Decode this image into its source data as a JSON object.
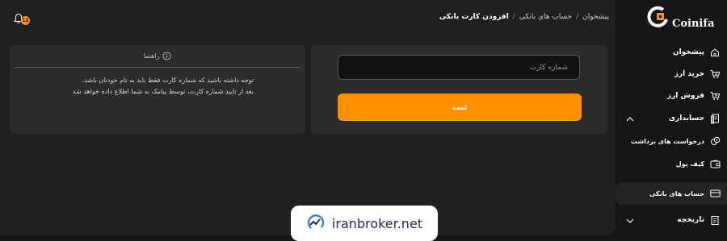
{
  "header": {
    "notification_count": "12",
    "breadcrumb": {
      "home": "پیشخوان",
      "bank_accounts": "حساب های بانکی",
      "current": "افزودن کارت بانکی",
      "separator": "/"
    }
  },
  "form": {
    "card_number_placeholder": "شماره کارت",
    "card_number_value": "",
    "submit_label": "ثبت"
  },
  "guide": {
    "title": "راهنما",
    "lines": [
      "توجه داشته باشید که شماره کارت فقط باید به نام خودتان باشد.",
      "بعد از تایید شماره کارت، توسط پیامک به شما اطلاع داده خواهد شد"
    ]
  },
  "sidebar": {
    "brand": "Coinifa",
    "items": [
      {
        "label": "پیشخوان",
        "icon": "home-icon"
      },
      {
        "label": "خرید ارز",
        "icon": "cart-in-icon"
      },
      {
        "label": "فروش ارز",
        "icon": "cart-out-icon"
      },
      {
        "label": "حسابداری",
        "icon": "ledger-icon"
      },
      {
        "label": "درخواست های برداشت",
        "icon": "coins-icon"
      },
      {
        "label": "کیف پول",
        "icon": "wallet-icon"
      },
      {
        "label": "حساب های بانکی",
        "icon": "card-icon"
      },
      {
        "label": "تاریخچه",
        "icon": "history-icon"
      }
    ]
  },
  "watermark": {
    "text": "iranbroker.net"
  },
  "colors": {
    "accent": "#ff9100",
    "background": "#151515",
    "panel": "#2c2c2c"
  }
}
